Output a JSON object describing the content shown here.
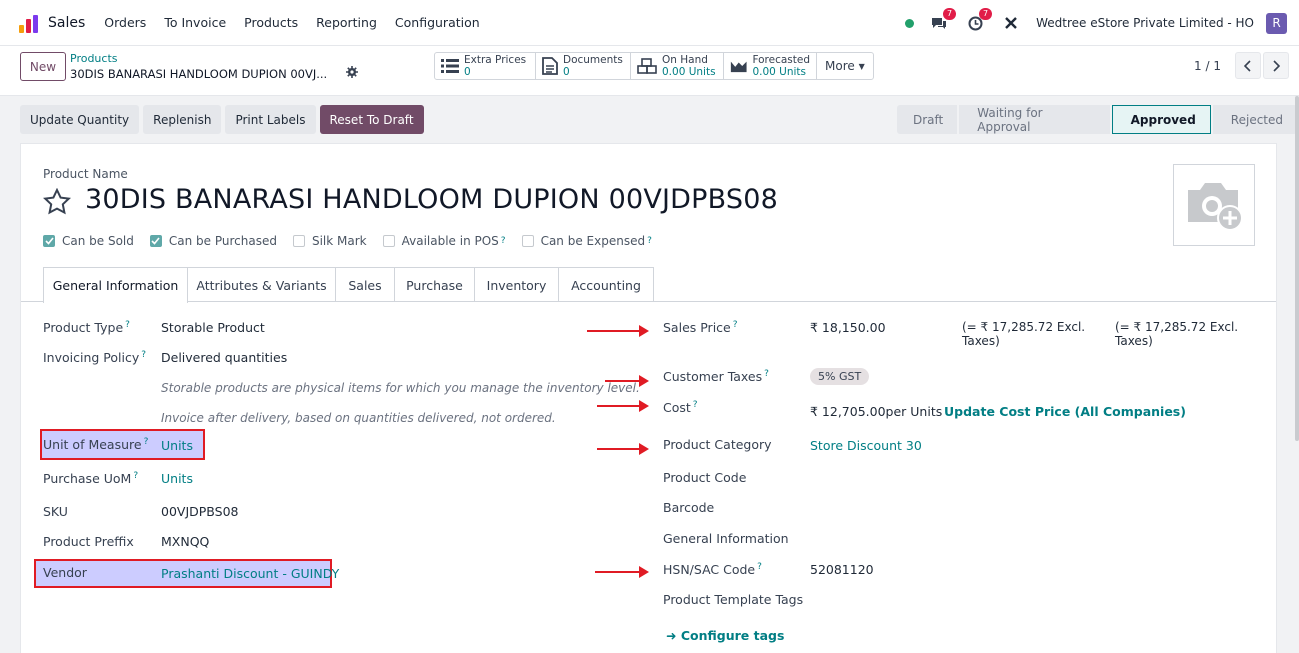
{
  "nav": {
    "app_name": "Sales",
    "menu": [
      "Orders",
      "To Invoice",
      "Products",
      "Reporting",
      "Configuration"
    ],
    "messages_badge": "7",
    "activities_badge": "7",
    "company": "Wedtree eStore Private Limited - HO",
    "avatar": "R"
  },
  "control": {
    "new_label": "New",
    "breadcrumb_parent": "Products",
    "breadcrumb_current": "30DIS BANARASI HANDLOOM DUPION 00VJ...",
    "smart_buttons": [
      {
        "label": "Extra Prices",
        "value": "0",
        "icon": "list-icon"
      },
      {
        "label": "Documents",
        "value": "0",
        "icon": "document-icon"
      },
      {
        "label": "On Hand",
        "value": "0.00 Units",
        "icon": "cubes-icon"
      },
      {
        "label": "Forecasted",
        "value": "0.00 Units",
        "icon": "area-chart-icon"
      }
    ],
    "more_label": "More",
    "pager": "1 / 1"
  },
  "actions": [
    "Update Quantity",
    "Replenish",
    "Print Labels",
    "Reset To Draft"
  ],
  "stages": [
    "Draft",
    "Waiting for Approval",
    "Approved",
    "Rejected"
  ],
  "active_stage": "Approved",
  "form": {
    "product_name_label": "Product Name",
    "product_name": "30DIS BANARASI HANDLOOM DUPION 00VJDPBS08",
    "checkboxes": [
      {
        "label": "Can be Sold",
        "checked": true
      },
      {
        "label": "Can be Purchased",
        "checked": true
      },
      {
        "label": "Silk Mark",
        "checked": false
      },
      {
        "label": "Available in POS",
        "checked": false
      },
      {
        "label": "Can be Expensed",
        "checked": false
      }
    ],
    "tabs": [
      "General Information",
      "Attributes & Variants",
      "Sales",
      "Purchase",
      "Inventory",
      "Accounting"
    ],
    "left": {
      "product_type_label": "Product Type",
      "product_type": "Storable Product",
      "invoicing_label": "Invoicing Policy",
      "invoicing": "Delivered quantities",
      "hint1": "Storable products are physical items for which you manage the inventory level.",
      "hint2": "Invoice after delivery, based on quantities delivered, not ordered.",
      "uom_label": "Unit of Measure",
      "uom": "Units",
      "purchase_uom_label": "Purchase UoM",
      "purchase_uom": "Units",
      "sku_label": "SKU",
      "sku": "00VJDPBS08",
      "prefix_label": "Product Preffix",
      "prefix": "MXNQQ",
      "vendor_label": "Vendor",
      "vendor": "Prashanti Discount - GUINDY"
    },
    "right": {
      "sales_price_label": "Sales Price",
      "sales_price": "₹ 18,150.00",
      "excl_1a": "(= ₹ 17,285.72 Excl.",
      "excl_1b": "Taxes)",
      "excl_2a": "(= ₹ 17,285.72 Excl.",
      "excl_2b": "Taxes)",
      "customer_taxes_label": "Customer Taxes",
      "customer_taxes": "5% GST",
      "cost_label": "Cost",
      "cost": "₹ 12,705.00per Units",
      "update_cost": "Update Cost Price (All Companies)",
      "category_label": "Product Category",
      "category": "Store Discount 30",
      "product_code_label": "Product Code",
      "barcode_label": "Barcode",
      "general_info_label": "General Information",
      "hsn_label": "HSN/SAC Code",
      "hsn": "52081120",
      "template_tags_label": "Product Template Tags",
      "configure_tags": "Configure tags"
    }
  },
  "colors": {
    "brand": "#714b67",
    "link": "#017e84",
    "annotation": "#e01b24"
  }
}
